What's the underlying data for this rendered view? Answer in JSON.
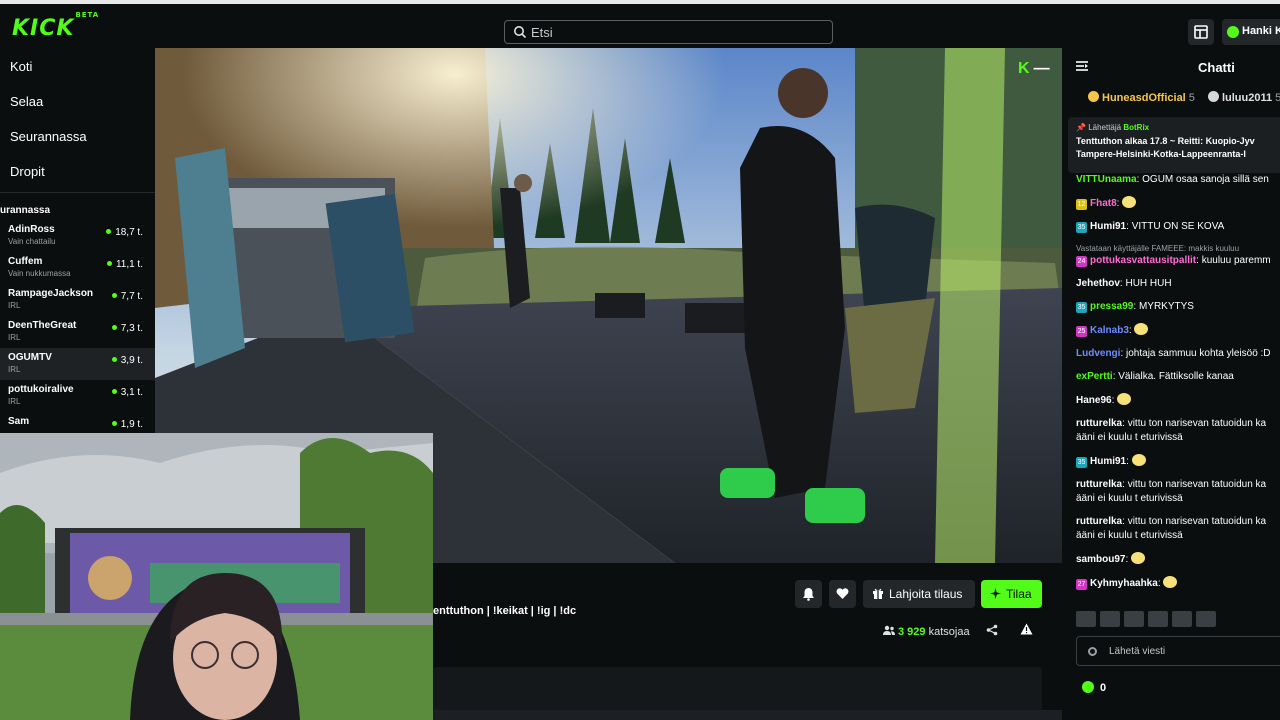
{
  "app": {
    "logo_text": "KICK",
    "logo_beta": "BETA",
    "accent": "#53fc18"
  },
  "search": {
    "placeholder": "Etsi"
  },
  "topbar": {
    "buy_label": "Hanki K"
  },
  "sidebar": {
    "nav": [
      {
        "label": "Koti"
      },
      {
        "label": "Selaa"
      },
      {
        "label": "Seurannassa"
      },
      {
        "label": "Dropit"
      }
    ],
    "section_title": "urannassa",
    "channels": [
      {
        "name": "AdinRoss",
        "sub": "Vain chattailu",
        "viewers": "18,7 t."
      },
      {
        "name": "Cuffem",
        "sub": "Vain nukkumassa",
        "viewers": "11,1 t."
      },
      {
        "name": "RampageJackson",
        "sub": "IRL",
        "viewers": "7,7 t."
      },
      {
        "name": "DeenTheGreat",
        "sub": "IRL",
        "viewers": "7,3 t."
      },
      {
        "name": "OGUMTV",
        "sub": "IRL",
        "viewers": "3,9 t."
      },
      {
        "name": "pottukoiralive",
        "sub": "IRL",
        "viewers": "3,1 t."
      },
      {
        "name": "Sam",
        "sub": "",
        "viewers": "1,9 t."
      }
    ]
  },
  "stream": {
    "title_tail": "enttuthon | !keikat | !ig | !dc",
    "gift_label": "Lahjoita tilaus",
    "subscribe_label": "Tilaa",
    "viewer_count": "3 929",
    "viewer_suffix": "katsojaa"
  },
  "chat": {
    "title": "Chatti",
    "top_gifters": [
      {
        "name": "HuneasdOfficial",
        "count": "5"
      },
      {
        "name": "luluu2011",
        "count": "5"
      }
    ],
    "pinned": {
      "sent_by_label": "Lähettäjä",
      "bot_name": "BotRix",
      "message_line1": "Tenttuthon alkaa 17.8 ~ Reitti: Kuopio-Jyv",
      "message_line2": "Tampere-Helsinki-Kotka-Lappeenranta-I"
    },
    "messages": [
      {
        "user": "VITTUnaama",
        "color": "#53fc18",
        "text": "OGUM osaa sanoja sillä sen"
      },
      {
        "user": "Fhat8",
        "color": "#ff6bd5",
        "text": "",
        "emote": true,
        "badge": "12",
        "badge_color": "#d8c21a"
      },
      {
        "user": "Humi91",
        "color": "#ffffff",
        "text": "VITTU ON SE KOVA",
        "badge": "35",
        "badge_color": "#1aa6b8"
      },
      {
        "user": "pottukasvattausitpallit",
        "color": "#ff6bd5",
        "text": "kuuluu paremm",
        "badge": "24",
        "badge_color": "#cf37c3",
        "reply": "Vastataan käyttäjälle FAMEEE: makkis kuuluu"
      },
      {
        "user": "Jehethov",
        "color": "#ffffff",
        "text": "HUH HUH"
      },
      {
        "user": "pressa99",
        "color": "#53fc18",
        "text": "MYRKYTYS",
        "badge": "35",
        "badge_color": "#1aa6b8"
      },
      {
        "user": "Kalnab3",
        "color": "#6c8cff",
        "text": "",
        "emote": true,
        "badge": "25",
        "badge_color": "#cf37c3"
      },
      {
        "user": "Ludvengi",
        "color": "#6c8cff",
        "text": "johtaja sammuu kohta yleisöö :D"
      },
      {
        "user": "exPertti",
        "color": "#53fc18",
        "text": "Välialka. Fättiksolle kanaa"
      },
      {
        "user": "Hane96",
        "color": "#ffffff",
        "text": "",
        "emote": true
      },
      {
        "user": "rutturelka",
        "color": "#ffffff",
        "text": "vittu ton narisevan tatuoidun ka",
        "line2": "ääni ei kuulu t eturivissä"
      },
      {
        "user": "Humi91",
        "color": "#ffffff",
        "text": "",
        "emote": true,
        "badge": "35",
        "badge_color": "#1aa6b8"
      },
      {
        "user": "rutturelka",
        "color": "#ffffff",
        "text": "vittu ton narisevan tatuoidun ka",
        "line2": "ääni ei kuulu t eturivissä"
      },
      {
        "user": "rutturelka",
        "color": "#ffffff",
        "text": "vittu ton narisevan tatuoidun ka",
        "line2": "ääni ei kuulu t eturivissä"
      },
      {
        "user": "sambou97",
        "color": "#ffffff",
        "text": "",
        "emote": true
      },
      {
        "user": "Kyhmyhaahka",
        "color": "#ffffff",
        "text": "",
        "emote": true,
        "badge": "27",
        "badge_color": "#cf37c3"
      }
    ],
    "input_placeholder": "Lähetä viesti",
    "points": "0"
  }
}
